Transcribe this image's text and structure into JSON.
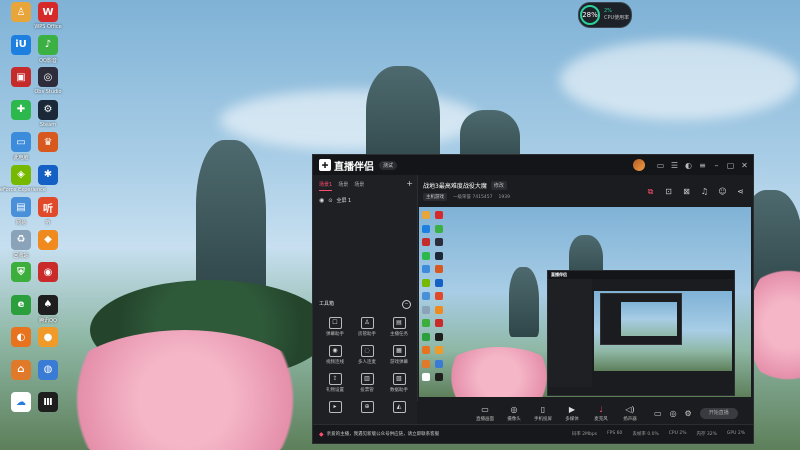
{
  "desktop": {
    "icons": [
      {
        "label": "",
        "icon": "user-icon",
        "color": "#e8a53a"
      },
      {
        "label": "WPS Office",
        "icon": "wps-icon",
        "color": "#d62a2a"
      },
      {
        "label": "",
        "icon": "store-icon",
        "color": "#1d7fe0"
      },
      {
        "label": "QQ影音",
        "icon": "qq-music-icon",
        "color": "#3cb043"
      },
      {
        "label": "",
        "icon": "app-icon",
        "color": "#c62b2b"
      },
      {
        "label": "Obs Studio",
        "icon": "obs-icon",
        "color": "#2c2c3a"
      },
      {
        "label": "",
        "icon": "plus-icon",
        "color": "#2db84d"
      },
      {
        "label": "Steam",
        "icon": "steam-icon",
        "color": "#1b2838"
      },
      {
        "label": "此电脑",
        "icon": "computer-icon",
        "color": "#3d8bdb"
      },
      {
        "label": "",
        "icon": "game-icon",
        "color": "#d8591f"
      },
      {
        "label": "GeForce Experience",
        "icon": "nvidia-icon",
        "color": "#76b900"
      },
      {
        "label": "",
        "icon": "blue-icon",
        "color": "#1560c4"
      },
      {
        "label": "网易",
        "icon": "folder-icon",
        "color": "#4a90d9"
      },
      {
        "label": "听",
        "icon": "listen-icon",
        "color": "#e04a2a"
      },
      {
        "label": "回收站",
        "icon": "recycle-icon",
        "color": "#8aa3b8"
      },
      {
        "label": "",
        "icon": "orange-icon",
        "color": "#f08a1e"
      },
      {
        "label": "",
        "icon": "shield-icon",
        "color": "#3cae3c"
      },
      {
        "label": "",
        "icon": "network-icon",
        "color": "#c92a2a"
      },
      {
        "label": "",
        "icon": "ie-icon",
        "color": "#2b9f3b"
      },
      {
        "label": "腾讯QQ",
        "icon": "qq-icon",
        "color": "#1e1e1e"
      },
      {
        "label": "",
        "icon": "orange2-icon",
        "color": "#e8731e"
      },
      {
        "label": "",
        "icon": "ball-icon",
        "color": "#f09a2a"
      },
      {
        "label": "",
        "icon": "house-icon",
        "color": "#e07a2a"
      },
      {
        "label": "",
        "icon": "globe-icon",
        "color": "#3a7bd5"
      },
      {
        "label": "",
        "icon": "cloud-icon",
        "color": "#ffffff"
      },
      {
        "label": "",
        "icon": "columns-icon",
        "color": "#1e1e1e"
      }
    ]
  },
  "perf": {
    "percent": "28%",
    "line1": "2%",
    "line2": "CPU使用率"
  },
  "app": {
    "name": "直播伴侣",
    "version": "测试",
    "tabs": [
      "场景1",
      "场景",
      "场景"
    ],
    "active_tab": "场景1",
    "scene_item": "全屏 1",
    "toolbox_title": "工具箱",
    "tools": [
      {
        "label": "弹幕助手",
        "icon": "barrage-icon"
      },
      {
        "label": "房管助手",
        "icon": "admin-icon"
      },
      {
        "label": "主播任务",
        "icon": "task-icon"
      },
      {
        "label": "视频连线",
        "icon": "video-link-icon"
      },
      {
        "label": "多人连麦",
        "icon": "multi-mic-icon"
      },
      {
        "label": "游戏弹幕",
        "icon": "game-barrage-icon"
      },
      {
        "label": "礼物设置",
        "icon": "gift-icon"
      },
      {
        "label": "投票管",
        "icon": "vote-icon"
      },
      {
        "label": "数据助手",
        "icon": "data-icon"
      },
      {
        "label": "",
        "icon": "more-icon"
      },
      {
        "label": "",
        "icon": "more2-icon"
      },
      {
        "label": "",
        "icon": "more3-icon"
      }
    ],
    "room_title": "战地3最高难度战役大魔",
    "room_edit": "修改",
    "room_category": "主机游戏",
    "room_meta1": "一级荣誉 7415457",
    "room_meta2": "1939",
    "controls": [
      {
        "label": "直播画面",
        "icon": "screen-icon"
      },
      {
        "label": "摄像头",
        "icon": "camera-icon"
      },
      {
        "label": "手机投屏",
        "icon": "phone-icon"
      },
      {
        "label": "多媒体",
        "icon": "media-icon"
      },
      {
        "label": "麦克风",
        "icon": "mic-icon"
      },
      {
        "label": "扬声器",
        "icon": "speaker-icon"
      }
    ],
    "start_label": "开始直播",
    "notice": "亲爱的主播，我遇见新版公众号供应链，请立即联系客服",
    "stats": [
      "码率 2Mbps",
      "FPS 60",
      "丢帧率 0.0%",
      "CPU 2%",
      "内存 32%",
      "GPU 2%"
    ]
  }
}
